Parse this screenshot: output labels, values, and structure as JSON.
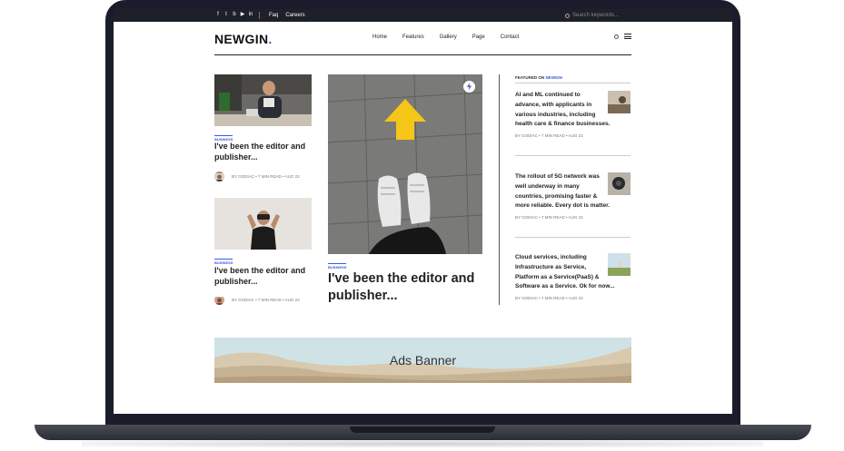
{
  "topbar": {
    "social_icons": [
      "facebook-icon",
      "twitter-icon",
      "behance-icon",
      "youtube-icon",
      "linkedin-icon"
    ],
    "links": [
      "Faq",
      "Careers"
    ],
    "search_placeholder": "Search keywords..."
  },
  "header": {
    "logo": "NEWGIN",
    "logo_dot": ".",
    "nav": [
      "Home",
      "Features",
      "Gallery",
      "Page",
      "Contact"
    ]
  },
  "left_cards": [
    {
      "tag": "BUSINESS",
      "title_line1": "I've been the editor and",
      "title_line2": "publisher...",
      "meta": "BY GODIAC • 7 MIN READ • AUG 23"
    },
    {
      "tag": "BUSINESS",
      "title_line1": "I've been the editor and",
      "title_line2": "publisher...",
      "meta": "BY GODIAC • 7 MIN READ • AUG 23"
    }
  ],
  "center_card": {
    "tag": "BUSINESS",
    "title_line1": "I've been the editor and",
    "title_line2": "publisher..."
  },
  "featured": {
    "heading_prefix": "FEATURED ON",
    "heading_brand": "NEWGIN",
    "items": [
      {
        "lines": [
          "AI and ML continued to",
          "advance, with applicants in",
          "various industries, including",
          "health care & finance businesses."
        ],
        "meta": "BY GODIAC • 7 MIN READ • AUG 23"
      },
      {
        "lines": [
          "The rollout of 5G network was",
          "well underway in many",
          "countries, promising faster &",
          "more reliable. Every dot is matter."
        ],
        "meta": "BY GODIAC • 7 MIN READ • AUG 23"
      },
      {
        "lines": [
          "Cloud services, including",
          "Infrastructure as Service,",
          "Platform as a Service(PaaS) &",
          "Software as a Service. Ok for now..."
        ],
        "meta": "BY GODIAC • 7 MIN READ • AUG 23"
      }
    ]
  },
  "ads": {
    "label": "Ads Banner"
  },
  "colors": {
    "accent": "#3b5bdb",
    "dark": "#1d1f2a",
    "arrow": "#f5c518"
  }
}
